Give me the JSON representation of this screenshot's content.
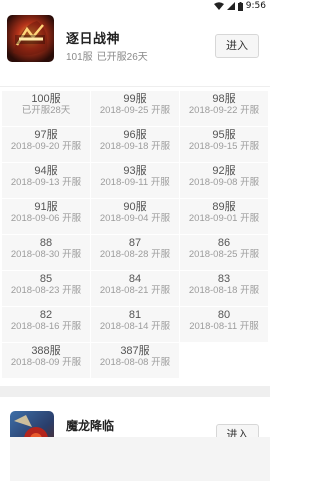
{
  "status_bar": {
    "time": "9:56",
    "icons": [
      "wifi-icon",
      "signal-icon",
      "battery-icon"
    ]
  },
  "game": {
    "title": "逐日战神",
    "latest_server": "101服",
    "open_status": "已开服26天",
    "enter_label": "进入",
    "icon": "game-icon-zhuri"
  },
  "servers": [
    {
      "name": "100服",
      "date": "已开服28天"
    },
    {
      "name": "99服",
      "date": "2018-09-25 开服"
    },
    {
      "name": "98服",
      "date": "2018-09-22 开服"
    },
    {
      "name": "97服",
      "date": "2018-09-20 开服"
    },
    {
      "name": "96服",
      "date": "2018-09-18 开服"
    },
    {
      "name": "95服",
      "date": "2018-09-15 开服"
    },
    {
      "name": "94服",
      "date": "2018-09-13 开服"
    },
    {
      "name": "93服",
      "date": "2018-09-11 开服"
    },
    {
      "name": "92服",
      "date": "2018-09-08 开服"
    },
    {
      "name": "91服",
      "date": "2018-09-06 开服"
    },
    {
      "name": "90服",
      "date": "2018-09-04 开服"
    },
    {
      "name": "89服",
      "date": "2018-09-01 开服"
    },
    {
      "name": "88",
      "date": "2018-08-30 开服"
    },
    {
      "name": "87",
      "date": "2018-08-28 开服"
    },
    {
      "name": "86",
      "date": "2018-08-25 开服"
    },
    {
      "name": "85",
      "date": "2018-08-23 开服"
    },
    {
      "name": "84",
      "date": "2018-08-21 开服"
    },
    {
      "name": "83",
      "date": "2018-08-18 开服"
    },
    {
      "name": "82",
      "date": "2018-08-16 开服"
    },
    {
      "name": "81",
      "date": "2018-08-14 开服"
    },
    {
      "name": "80",
      "date": "2018-08-11 开服"
    },
    {
      "name": "388服",
      "date": "2018-08-09 开服"
    },
    {
      "name": "387服",
      "date": "2018-08-08 开服"
    }
  ],
  "game2": {
    "title": "魔龙降临",
    "enter_label": "进入",
    "icon": "game-icon-molong"
  },
  "colors": {
    "cell_bg": "#f7f7f7",
    "separator": "#efefef",
    "date_text": "#9c9c9c"
  }
}
